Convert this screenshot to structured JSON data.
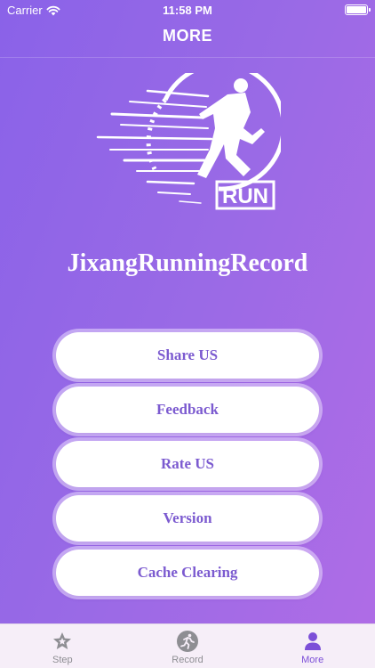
{
  "status_bar": {
    "carrier": "Carrier",
    "time": "11:58 PM"
  },
  "nav": {
    "title": "MORE"
  },
  "logo": {
    "text": "RUN"
  },
  "app_name": "JixangRunningRecord",
  "menu": {
    "items": [
      {
        "label": "Share US"
      },
      {
        "label": "Feedback"
      },
      {
        "label": "Rate US"
      },
      {
        "label": "Version"
      },
      {
        "label": "Cache Clearing"
      }
    ]
  },
  "tab_bar": {
    "tabs": [
      {
        "label": "Step",
        "icon": "star-icon",
        "active": false
      },
      {
        "label": "Record",
        "icon": "runner-icon",
        "active": false
      },
      {
        "label": "More",
        "icon": "person-icon",
        "active": true
      }
    ]
  },
  "colors": {
    "background_start": "#8a62e8",
    "background_end": "#b06ce6",
    "button_text": "#7c5bd0",
    "tab_active": "#7c4fd8",
    "tab_inactive": "#8e8e93"
  }
}
